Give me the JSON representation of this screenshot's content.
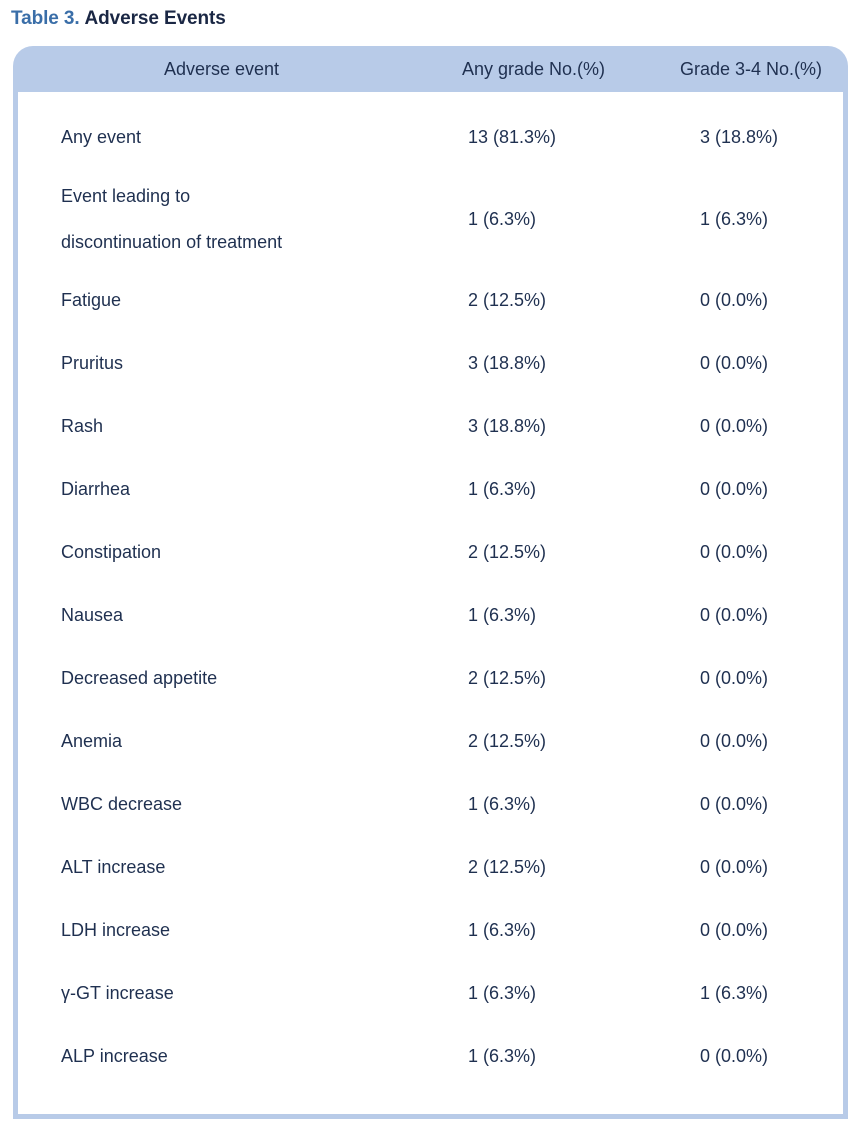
{
  "caption": {
    "label": "Table 3.",
    "title": "Adverse Events",
    "label_color": "#3a6ea8",
    "title_color": "#1a2744"
  },
  "table": {
    "header_bg": "#b8cbe8",
    "text_color": "#1f3050",
    "columns": [
      {
        "key": "event",
        "header": "Adverse event"
      },
      {
        "key": "any_grade",
        "header": "Any grade No.(%)"
      },
      {
        "key": "grade_3_4",
        "header": "Grade 3-4 No.(%)"
      }
    ],
    "rows": [
      {
        "event": "Any event",
        "event_lines": [
          "Any event"
        ],
        "any_grade": "13 (81.3%)",
        "grade_3_4": "3 (18.8%)"
      },
      {
        "event": "Event leading to discontinuation of treatment",
        "event_lines": [
          "Event leading to",
          "discontinuation of treatment"
        ],
        "any_grade": "1 (6.3%)",
        "grade_3_4": "1 (6.3%)"
      },
      {
        "event": "Fatigue",
        "event_lines": [
          "Fatigue"
        ],
        "any_grade": "2 (12.5%)",
        "grade_3_4": "0 (0.0%)"
      },
      {
        "event": "Pruritus",
        "event_lines": [
          "Pruritus"
        ],
        "any_grade": "3 (18.8%)",
        "grade_3_4": "0 (0.0%)"
      },
      {
        "event": "Rash",
        "event_lines": [
          "Rash"
        ],
        "any_grade": "3 (18.8%)",
        "grade_3_4": "0 (0.0%)"
      },
      {
        "event": "Diarrhea",
        "event_lines": [
          "Diarrhea"
        ],
        "any_grade": "1 (6.3%)",
        "grade_3_4": "0 (0.0%)"
      },
      {
        "event": "Constipation",
        "event_lines": [
          "Constipation"
        ],
        "any_grade": "2 (12.5%)",
        "grade_3_4": "0 (0.0%)"
      },
      {
        "event": "Nausea",
        "event_lines": [
          "Nausea"
        ],
        "any_grade": "1 (6.3%)",
        "grade_3_4": "0 (0.0%)"
      },
      {
        "event": "Decreased appetite",
        "event_lines": [
          "Decreased appetite"
        ],
        "any_grade": "2 (12.5%)",
        "grade_3_4": "0 (0.0%)"
      },
      {
        "event": "Anemia",
        "event_lines": [
          "Anemia"
        ],
        "any_grade": "2 (12.5%)",
        "grade_3_4": "0 (0.0%)"
      },
      {
        "event": "WBC decrease",
        "event_lines": [
          "WBC decrease"
        ],
        "any_grade": "1 (6.3%)",
        "grade_3_4": "0 (0.0%)"
      },
      {
        "event": "ALT increase",
        "event_lines": [
          "ALT increase"
        ],
        "any_grade": "2 (12.5%)",
        "grade_3_4": "0 (0.0%)"
      },
      {
        "event": "LDH increase",
        "event_lines": [
          "LDH increase"
        ],
        "any_grade": "1 (6.3%)",
        "grade_3_4": "0 (0.0%)"
      },
      {
        "event": "γ-GT increase",
        "event_lines": [
          "γ-GT increase"
        ],
        "any_grade": "1 (6.3%)",
        "grade_3_4": "1 (6.3%)"
      },
      {
        "event": "ALP increase",
        "event_lines": [
          "ALP increase"
        ],
        "any_grade": "1 (6.3%)",
        "grade_3_4": "0 (0.0%)"
      }
    ]
  }
}
